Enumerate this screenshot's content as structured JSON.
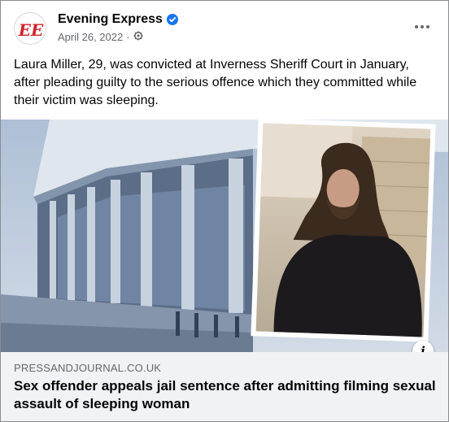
{
  "post": {
    "page_name": "Evening Express",
    "logo_text": "EE",
    "date": "April 26, 2022",
    "separator": "·",
    "body_text": "Laura Miller, 29, was convicted at Inverness Sheriff Court in January, after pleading guilty to the serious offence which they committed while their victim was sleeping.",
    "icons": {
      "verified": "verified-badge-icon",
      "privacy": "public-globe-icon",
      "more": "more-options-icon",
      "info": "info-icon"
    },
    "info_glyph": "i"
  },
  "link_preview": {
    "domain": "PRESSANDJOURNAL.CO.UK",
    "headline": "Sex offender appeals jail sentence after admitting filming sexual assault of sleeping woman"
  },
  "colors": {
    "brand_red": "#d2232a",
    "verified_blue": "#1877f2",
    "footer_bg": "#f0f2f5",
    "secondary_text": "#65676b"
  }
}
